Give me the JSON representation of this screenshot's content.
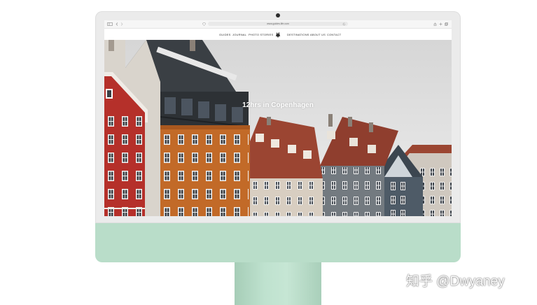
{
  "browser": {
    "url": "www.guides.life.com",
    "toolbar_icons": [
      "sidebar-icon",
      "back-icon",
      "forward-icon",
      "share-icon",
      "new-tab-icon",
      "tabs-icon"
    ]
  },
  "site": {
    "nav_items": [
      "GUIDES",
      "JOURNAL",
      "PHOTO STORIES",
      "DESTINATIONS",
      "ABOUT US",
      "CONTACT"
    ],
    "hero_title": "12hrs in Copenhagen"
  },
  "watermark": {
    "text": "知乎 @Dwyaney"
  },
  "colors": {
    "imac_bezel": "#ebebeb",
    "imac_chin": "#b9ddc9",
    "sky": "#dedede",
    "house_red": "#b8322a",
    "house_orange": "#c46a26",
    "house_beige": "#d9cfc2",
    "house_grey": "#6d7378",
    "house_slate": "#44505c",
    "roof_dark": "#3a3f44",
    "roof_red": "#8e3b2a"
  }
}
